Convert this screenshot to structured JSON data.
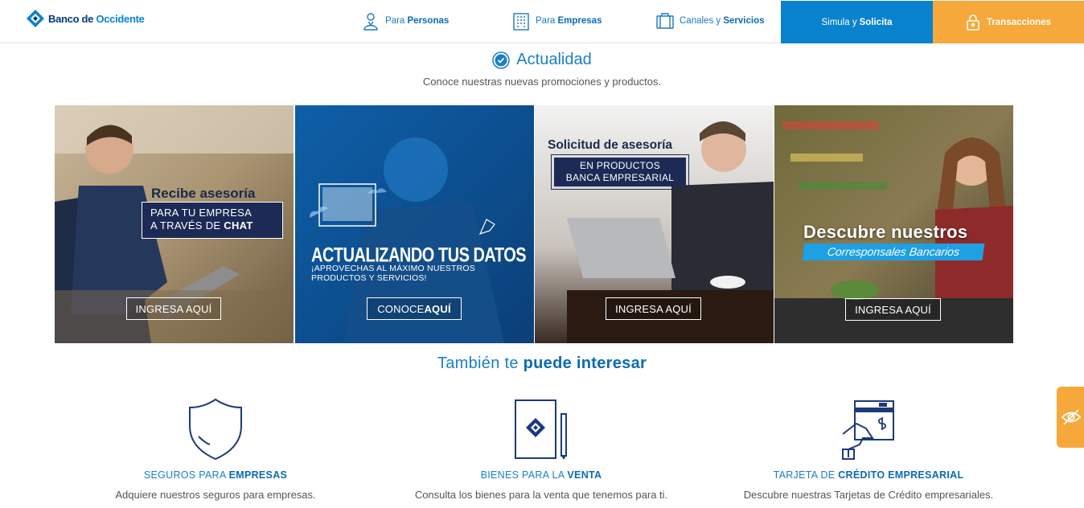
{
  "brand": {
    "name_part1": "Banco de ",
    "name_part2": "Occidente"
  },
  "nav": {
    "personas": {
      "prefix": "Para ",
      "strong": "Personas"
    },
    "empresas": {
      "prefix": "Para ",
      "strong": "Empresas"
    },
    "canales": {
      "prefix": "Canales y ",
      "strong": "Servicios"
    },
    "simula": {
      "prefix": "Simula y ",
      "strong": "Solicita"
    },
    "transacciones": "Transacciones"
  },
  "section": {
    "title": "Actualidad",
    "subtitle": "Conoce nuestras nuevas promociones y productos."
  },
  "cards": [
    {
      "title": "Recibe asesoría",
      "line1": "PARA TU EMPRESA",
      "line2_prefix": "A TRAVÉS DE ",
      "line2_strong": "CHAT",
      "button": "INGRESA AQUÍ"
    },
    {
      "title": "ACTUALIZANDO TUS DATOS",
      "sub1": "¡APROVECHAS AL MÁXIMO NUESTROS",
      "sub2": "PRODUCTOS Y SERVICIOS!",
      "button_prefix": "CONOCE ",
      "button_strong": "AQUÍ"
    },
    {
      "title": "Solicitud de asesoría",
      "line1": "EN PRODUCTOS",
      "line2": "BANCA EMPRESARIAL",
      "button": "INGRESA AQUÍ"
    },
    {
      "title": "Descubre nuestros",
      "sub": "Corresponsales Bancarios",
      "button": "INGRESA AQUÍ"
    }
  ],
  "also": {
    "prefix": "También te ",
    "strong": "puede interesar"
  },
  "features": [
    {
      "title_prefix": "SEGUROS PARA ",
      "title_strong": "EMPRESAS",
      "desc": "Adquiere nuestros seguros para empresas.",
      "icon": "shield-icon"
    },
    {
      "title_prefix": "BIENES PARA LA ",
      "title_strong": "VENTA",
      "desc": "Consulta los bienes para la venta que tenemos para ti.",
      "icon": "notebook-icon"
    },
    {
      "title_prefix": "TARJETA DE ",
      "title_strong": "CRÉDITO EMPRESARIAL",
      "desc": "Descubre nuestras Tarjetas de Crédito empresariales.",
      "icon": "credit-card-hand-icon"
    }
  ],
  "colors": {
    "primary": "#0a83cf",
    "dark_blue": "#003a7d",
    "orange": "#f6a83a",
    "navy": "#1c2a55"
  }
}
